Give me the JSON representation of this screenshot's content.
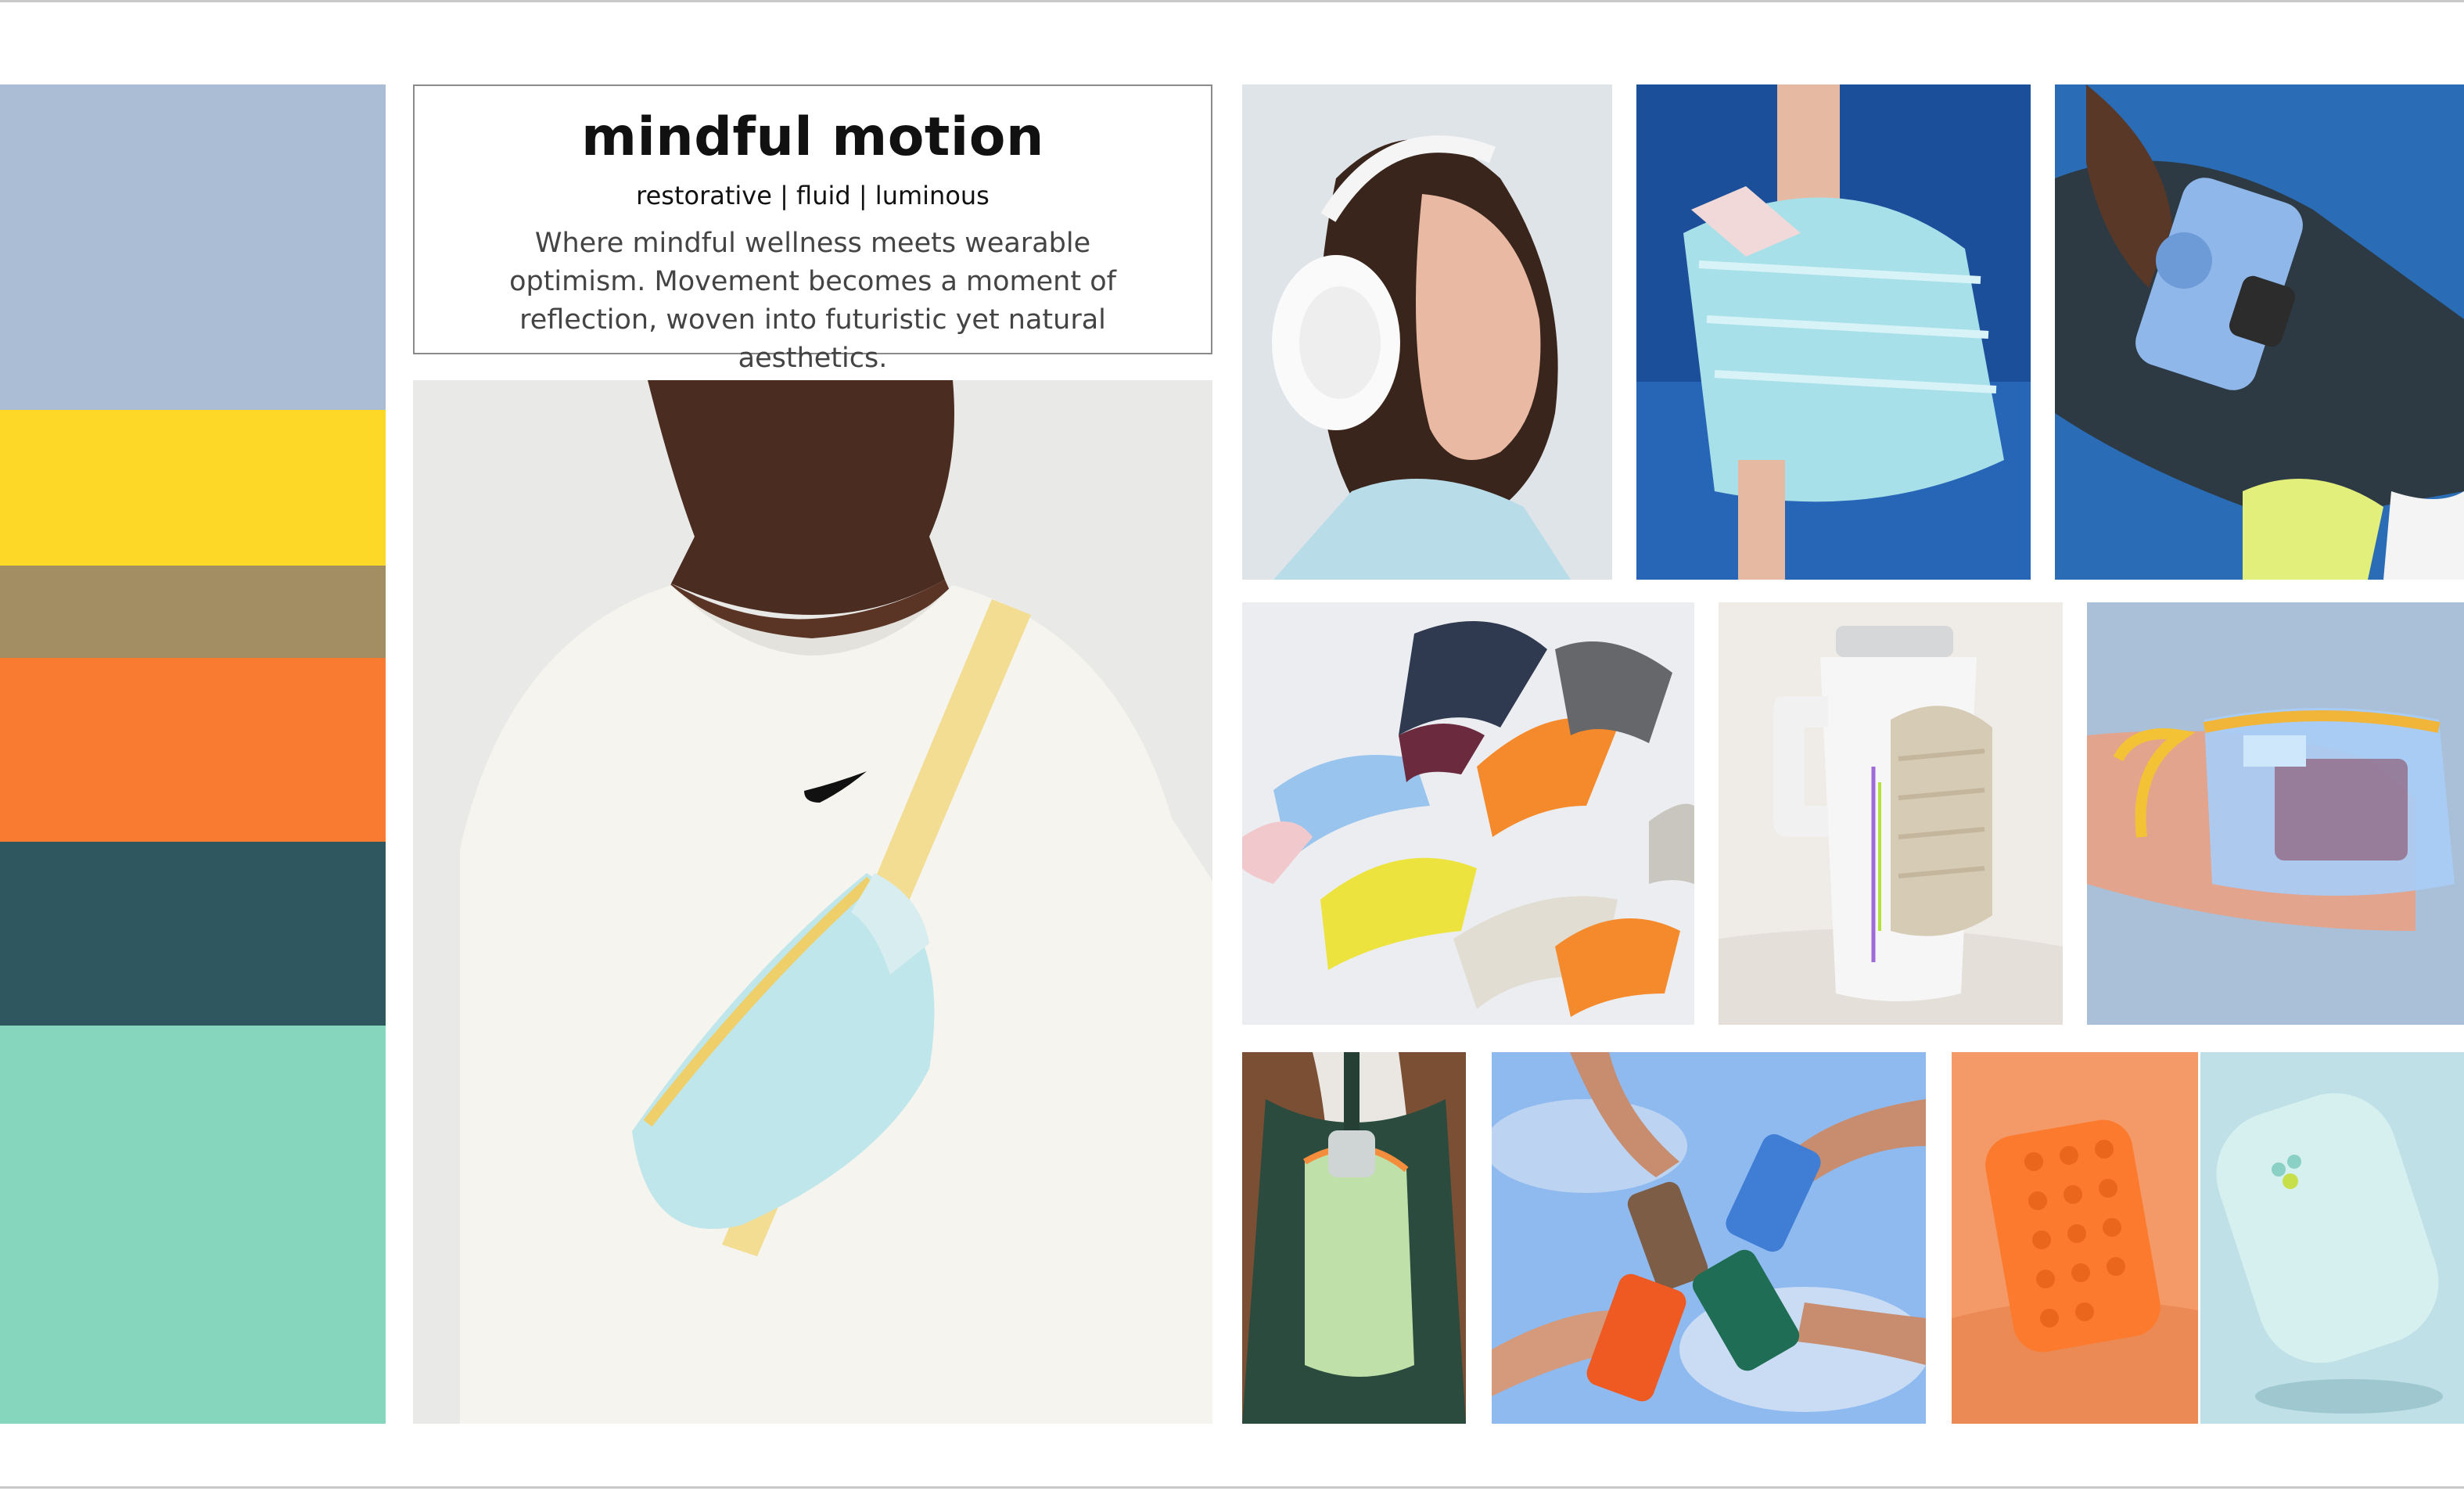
{
  "moodboard": {
    "title": "mindful motion",
    "keywords": "restorative | fluid | luminous",
    "description": "Where mindful wellness meets wearable optimism. Movement becomes a moment of reflection, woven into futuristic yet natural aesthetics."
  },
  "palette": [
    {
      "name": "periwinkle-blue",
      "color": "#aabdd5"
    },
    {
      "name": "sunshine-yellow",
      "color": "#fdd826"
    },
    {
      "name": "khaki",
      "color": "#a28e62"
    },
    {
      "name": "tangerine",
      "color": "#f97b32"
    },
    {
      "name": "deep-teal",
      "color": "#2e5760"
    },
    {
      "name": "mint-green",
      "color": "#86d5bd"
    }
  ],
  "photos": [
    {
      "name": "hip-bag-sweatshirt-photo",
      "subject": "person in white sweatshirt with light blue crossbody bag"
    },
    {
      "name": "headphones-photo",
      "subject": "woman wearing white headphones"
    },
    {
      "name": "pickleball-bag-photo",
      "subject": "quilted light blue paddle bag"
    },
    {
      "name": "phone-case-photo",
      "subject": "blue phone case held on court"
    },
    {
      "name": "watch-bands-photo",
      "subject": "ridged silicone watch bands"
    },
    {
      "name": "tumbler-pouch-photo",
      "subject": "white tumbler with quilted pouch"
    },
    {
      "name": "clear-pouch-photo",
      "subject": "translucent blue zip pouch in hand"
    },
    {
      "name": "bottle-sling-photo",
      "subject": "mint bottle sling on back"
    },
    {
      "name": "phone-hands-photo",
      "subject": "hands holding colorful phones against sky"
    },
    {
      "name": "orange-grip-photo",
      "subject": "orange silicone grip pad"
    },
    {
      "name": "power-bank-photo",
      "subject": "pale blue rounded power bank"
    }
  ]
}
